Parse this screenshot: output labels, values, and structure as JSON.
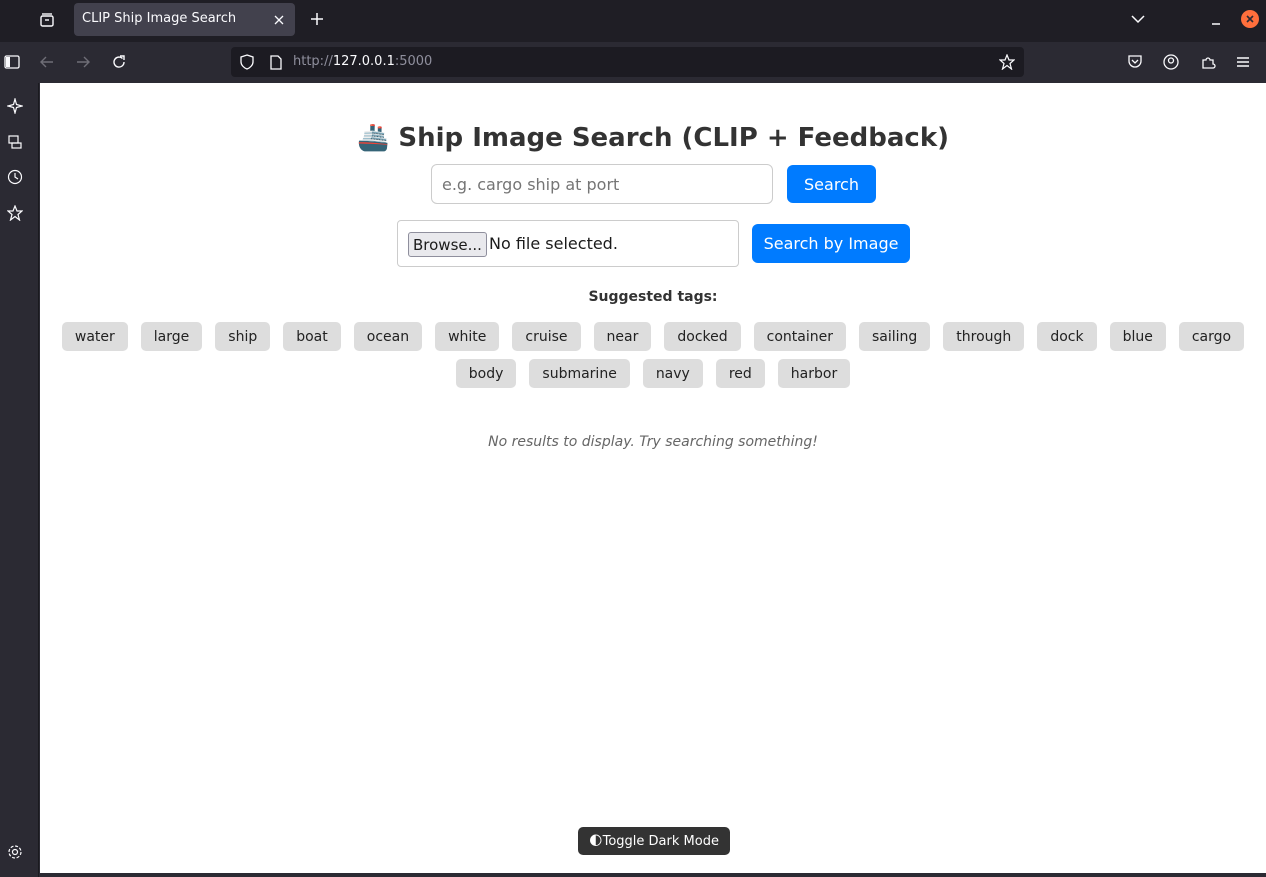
{
  "browser": {
    "tab_title": "CLIP Ship Image Search",
    "url_scheme": "http://",
    "url_host": "127.0.0.1",
    "url_port": ":5000"
  },
  "page": {
    "title_icon": "🚢",
    "title": "Ship Image Search (CLIP + Feedback)",
    "search_placeholder": "e.g. cargo ship at port",
    "search_button": "Search",
    "browse_button": "Browse...",
    "file_status": "No file selected.",
    "image_search_button": "Search by Image",
    "tags_label": "Suggested tags:",
    "tags_row1": [
      "water",
      "large",
      "ship",
      "boat",
      "ocean",
      "white",
      "cruise",
      "near",
      "docked",
      "container",
      "sailing",
      "through",
      "dock",
      "blue",
      "cargo"
    ],
    "tags_row2": [
      "body",
      "submarine",
      "navy",
      "red",
      "harbor"
    ],
    "no_results": "No results to display. Try searching something!",
    "dark_mode_icon": "🌓",
    "dark_mode_button": "Toggle Dark Mode"
  },
  "colors": {
    "primary": "#007bff",
    "tag_bg": "#dddddd",
    "toggle_bg": "#333333"
  }
}
